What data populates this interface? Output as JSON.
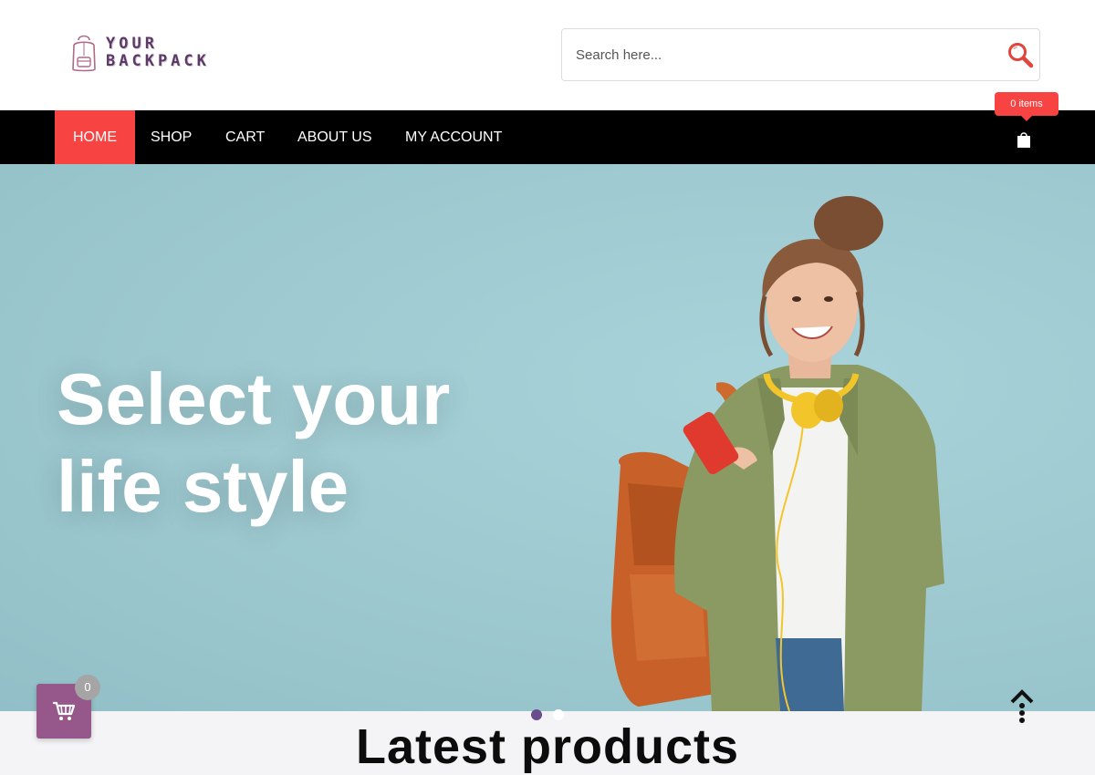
{
  "header": {
    "logo": {
      "line1": "YOUR",
      "line2": "BACKPACK"
    },
    "search": {
      "placeholder": "Search here...",
      "value": ""
    }
  },
  "nav": {
    "items": [
      {
        "label": "HOME",
        "active": true
      },
      {
        "label": "SHOP"
      },
      {
        "label": "CART"
      },
      {
        "label": "ABOUT US"
      },
      {
        "label": "MY ACCOUNT"
      }
    ],
    "cart_badge": "0 items"
  },
  "hero": {
    "title_line1": "Select your",
    "title_line2": "life style",
    "slide_count": 2,
    "active_slide": 1
  },
  "latest": {
    "heading": "Latest products"
  },
  "floating_cart": {
    "count": "0"
  },
  "icons": {
    "logo": "backpack-icon",
    "search": "search-icon",
    "nav_cart": "shopping-bag-icon",
    "floating_cart": "cart-icon",
    "scroll": "scroll-top-icon"
  },
  "colors": {
    "accent": "#f84343",
    "nav_bg": "#000000",
    "hero_bg": "#9fcad1",
    "floating_cart_bg": "#96588a",
    "active_dot": "#6a4c8c",
    "logo_text": "#5b3a63"
  }
}
